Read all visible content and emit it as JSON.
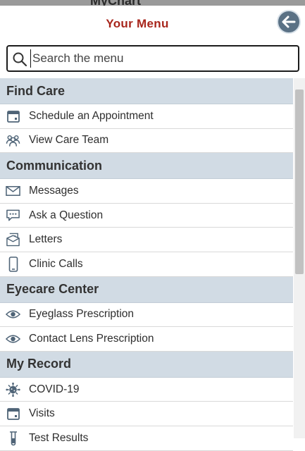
{
  "app": {
    "name_peek": "MyChart"
  },
  "header": {
    "title": "Your Menu",
    "back_icon": "arrow-left-icon"
  },
  "search": {
    "placeholder": "Search the menu",
    "value": "",
    "icon": "search-icon"
  },
  "colors": {
    "title": "#a8261c",
    "section_bg": "#d1dbe4",
    "icon": "#4f6477",
    "back_button": "#5a7185"
  },
  "sections": [
    {
      "title": "Find Care",
      "items": [
        {
          "label": "Schedule an Appointment",
          "icon": "calendar-icon"
        },
        {
          "label": "View Care Team",
          "icon": "care-team-icon"
        }
      ]
    },
    {
      "title": "Communication",
      "items": [
        {
          "label": "Messages",
          "icon": "envelope-icon"
        },
        {
          "label": "Ask a Question",
          "icon": "speech-bubble-icon"
        },
        {
          "label": "Letters",
          "icon": "letters-icon"
        },
        {
          "label": "Clinic Calls",
          "icon": "phone-icon"
        }
      ]
    },
    {
      "title": "Eyecare Center",
      "items": [
        {
          "label": "Eyeglass Prescription",
          "icon": "eye-icon"
        },
        {
          "label": "Contact Lens Prescription",
          "icon": "eye-icon"
        }
      ]
    },
    {
      "title": "My Record",
      "items": [
        {
          "label": "COVID-19",
          "icon": "virus-icon"
        },
        {
          "label": "Visits",
          "icon": "calendar-icon"
        },
        {
          "label": "Test Results",
          "icon": "test-tube-icon"
        }
      ]
    }
  ]
}
